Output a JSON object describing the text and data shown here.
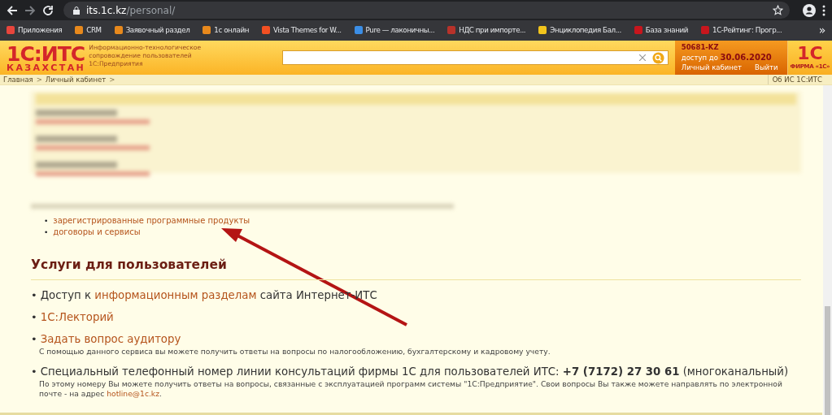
{
  "browser": {
    "url_host": "its.1c.kz",
    "url_path": "/personal/",
    "bookmarks": [
      {
        "label": "Приложения",
        "color": "#e8453c"
      },
      {
        "label": "CRM",
        "color": "#e8891c"
      },
      {
        "label": "Заявочный раздел",
        "color": "#e8891c"
      },
      {
        "label": "1с онлайн",
        "color": "#e8891c"
      },
      {
        "label": "Vista Themes for W...",
        "color": "#f25022"
      },
      {
        "label": "Pure — лаконичны...",
        "color": "#3b8ee6"
      },
      {
        "label": "НДС при импорте...",
        "color": "#b8322a"
      },
      {
        "label": "Энциклопедия Бал...",
        "color": "#f2c51c"
      },
      {
        "label": "База знаний",
        "color": "#c8161d"
      },
      {
        "label": "1С-Рейтинг: Прогр...",
        "color": "#c8161d"
      }
    ],
    "overflow": "»"
  },
  "header": {
    "logo": "1С:ИТС",
    "region": "КАЗАХСТАН",
    "tagline": [
      "Информационно-технологическое",
      "сопровождение пользователей",
      "1С:Предприятия"
    ],
    "account": {
      "id": "50681-KZ",
      "access_label": "доступ до",
      "access_date": "30.06.2020",
      "links": [
        "Личный кабинет",
        "Выйти"
      ]
    },
    "brand": "1С",
    "brand_caption": "ФИРМА «1С»"
  },
  "breadcrumbs": [
    "Главная",
    "Личный кабинет"
  ],
  "breadcrumb_separator": ">",
  "bullet": "•",
  "about_link": "Об ИС 1С:ИТС",
  "links": [
    "зарегистрированные программные продукты",
    "договоры и сервисы"
  ],
  "section_title": "Услуги для пользователей",
  "services": [
    {
      "parts": [
        {
          "text": "Доступ к ",
          "kind": "text"
        },
        {
          "text": "информационным разделам",
          "kind": "link"
        },
        {
          "text": " сайта Интернет-ИТС",
          "kind": "text"
        }
      ]
    },
    {
      "parts": [
        {
          "text": "1С:Лекторий",
          "kind": "link"
        }
      ]
    },
    {
      "parts": [
        {
          "text": "Задать вопрос аудитору",
          "kind": "link"
        }
      ],
      "note": [
        {
          "text": "С помощью данного сервиса вы можете получить ответы на вопросы по налогообложению, бухгалтерскому и кадровому учету.",
          "kind": "text"
        }
      ]
    },
    {
      "parts": [
        {
          "text": "Специальный телефонный номер линии консультаций фирмы 1С для пользователей ИТС: **+7 (7172) 27 30 61** (многоканальный)",
          "kind": "text"
        }
      ],
      "note": [
        {
          "text": "По этому номеру Вы можете получить ответы на вопросы, связанные с эксплуатацией программ системы \"1С:Предприятие\". Свои вопросы Вы также можете направлять по электронной почте - на адрес ",
          "kind": "text"
        },
        {
          "text": "hotline@1c.kz",
          "kind": "link"
        },
        {
          "text": ".",
          "kind": "text"
        }
      ]
    }
  ]
}
